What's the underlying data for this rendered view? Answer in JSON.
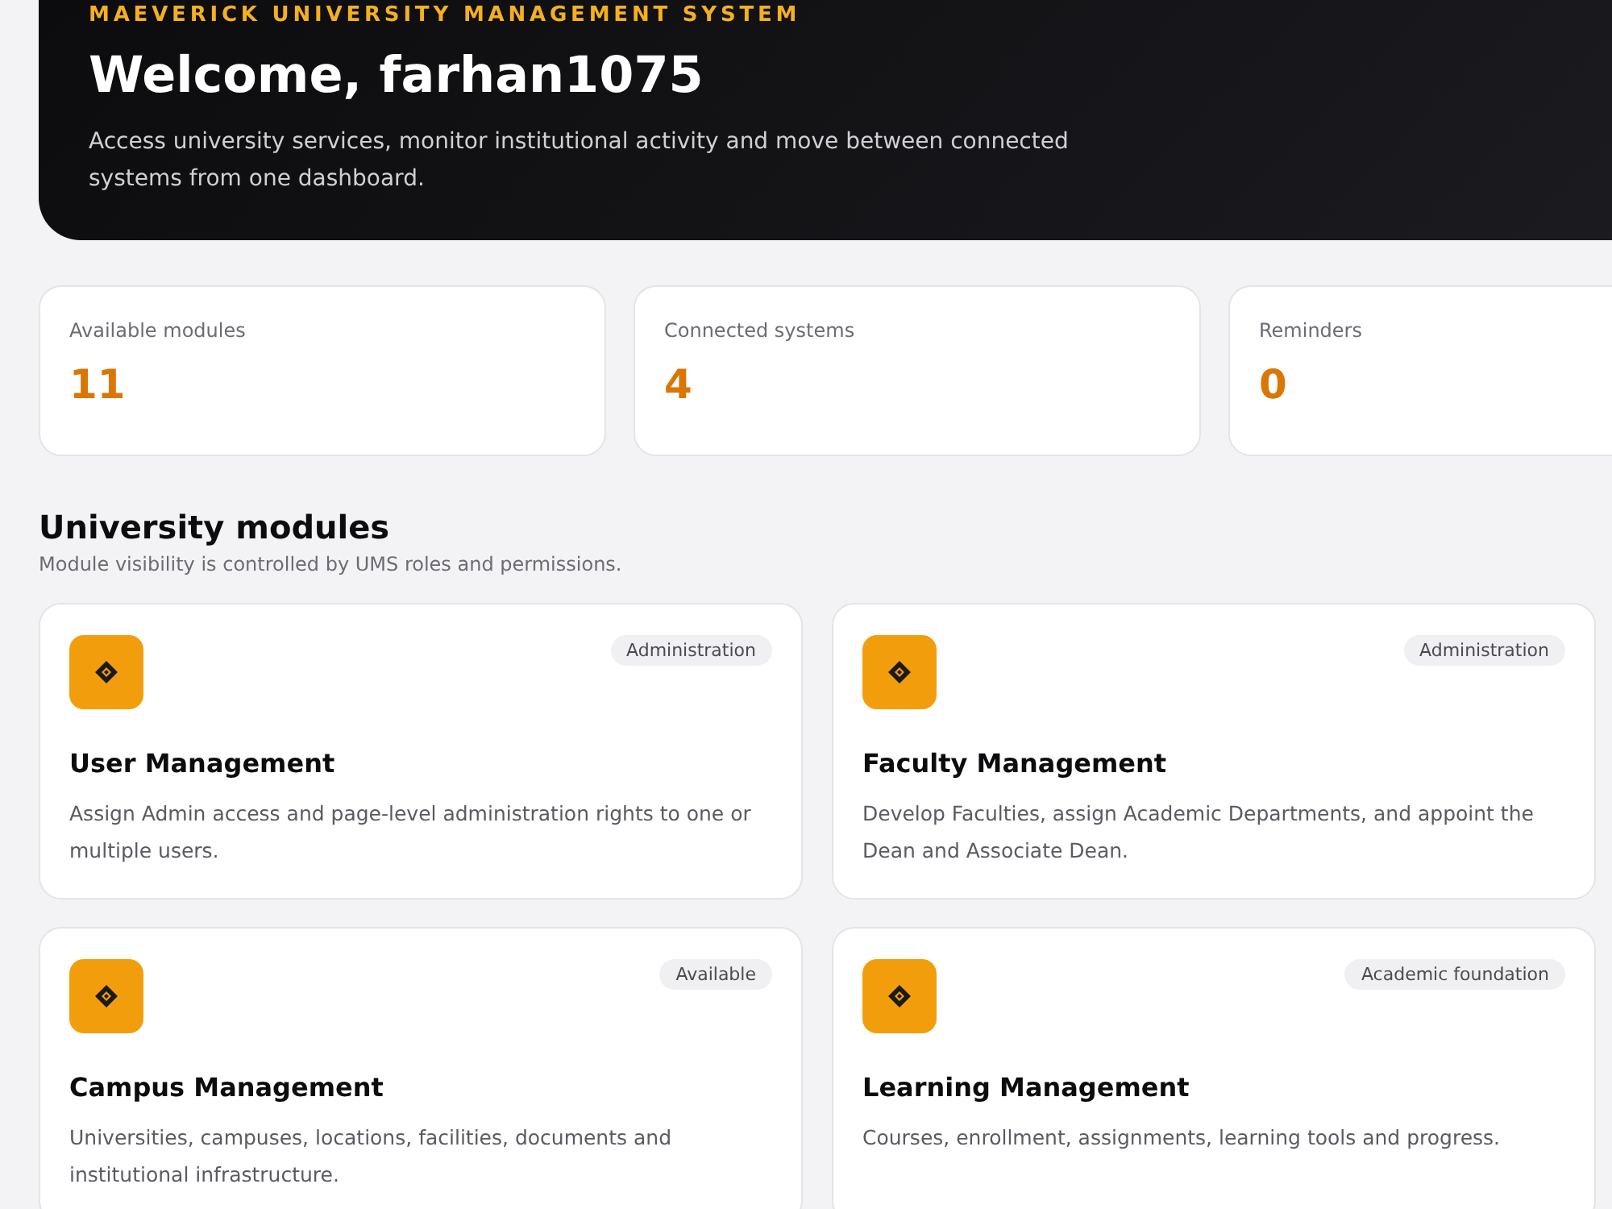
{
  "hero": {
    "eyebrow": "MAEVERICK UNIVERSITY MANAGEMENT SYSTEM",
    "title": "Welcome, farhan1075",
    "subtitle": "Access university services, monitor institutional activity and move between connected systems from one dashboard."
  },
  "stats": [
    {
      "label": "Available modules",
      "value": "11"
    },
    {
      "label": "Connected systems",
      "value": "4"
    },
    {
      "label": "Reminders",
      "value": "0"
    }
  ],
  "modules_section": {
    "title": "University modules",
    "subtitle": "Module visibility is controlled by UMS roles and permissions."
  },
  "modules": [
    {
      "title": "User Management",
      "tag": "Administration",
      "description": "Assign Admin access and page-level administration rights to one or multiple users."
    },
    {
      "title": "Faculty Management",
      "tag": "Administration",
      "description": "Develop Faculties, assign Academic Departments, and appoint the Dean and Associate Dean."
    },
    {
      "title": "Campus Management",
      "tag": "Available",
      "description": "Universities, campuses, locations, facilities, documents and institutional infrastructure."
    },
    {
      "title": "Learning Management",
      "tag": "Academic foundation",
      "description": "Courses, enrollment, assignments, learning tools and progress."
    }
  ]
}
